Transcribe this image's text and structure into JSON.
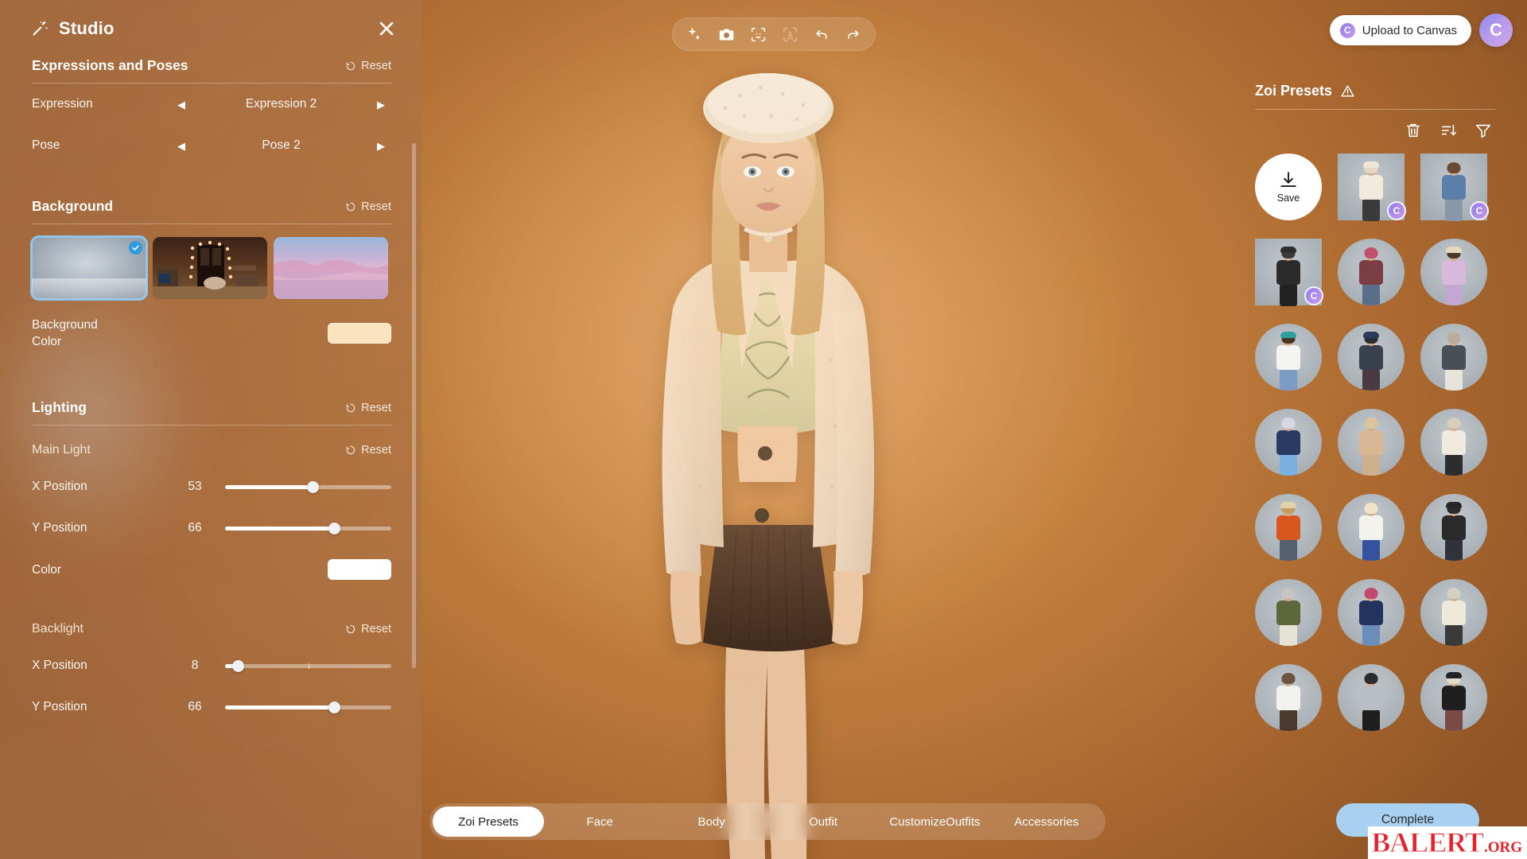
{
  "studio": {
    "title": "Studio",
    "wand_icon": "magic-wand-icon",
    "close_icon": "close-icon",
    "sections": {
      "expressions": {
        "title": "Expressions and Poses",
        "reset_label": "Reset",
        "rows": [
          {
            "label": "Expression",
            "value": "Expression 2"
          },
          {
            "label": "Pose",
            "value": "Pose 2"
          }
        ]
      },
      "background": {
        "title": "Background",
        "reset_label": "Reset",
        "thumbnails": [
          {
            "name": "studio-backdrop",
            "selected": true
          },
          {
            "name": "interior-room",
            "selected": false
          },
          {
            "name": "sunset-ocean",
            "selected": false
          }
        ],
        "color_label_line1": "Background",
        "color_label_line2": "Color",
        "color_value": "#fae3bd"
      },
      "lighting": {
        "title": "Lighting",
        "reset_label": "Reset",
        "main_light": {
          "title": "Main Light",
          "reset_label": "Reset",
          "x_label": "X Position",
          "x_value": 53,
          "y_label": "Y Position",
          "y_value": 66,
          "color_label": "Color",
          "color_value": "#ffffff"
        },
        "backlight": {
          "title": "Backlight",
          "reset_label": "Reset",
          "x_label": "X Position",
          "x_value": 8,
          "y_label": "Y Position",
          "y_value": 66
        }
      }
    }
  },
  "toolbar": {
    "items": [
      {
        "icon": "sparkle-icon",
        "enabled": true
      },
      {
        "icon": "camera-icon",
        "enabled": true
      },
      {
        "icon": "face-scan-icon",
        "enabled": true
      },
      {
        "icon": "body-scan-icon",
        "enabled": false
      },
      {
        "icon": "undo-icon",
        "enabled": true
      },
      {
        "icon": "redo-icon",
        "enabled": true
      }
    ]
  },
  "header": {
    "upload_label": "Upload to Canvas",
    "upload_icon": "canvas-logo-icon",
    "profile_icon": "profile-avatar"
  },
  "presets": {
    "title": "Zoi Presets",
    "warning_icon": "warning-triangle-icon",
    "tools": [
      {
        "icon": "trash-icon"
      },
      {
        "icon": "sort-icon"
      },
      {
        "icon": "filter-icon"
      }
    ],
    "save_label": "Save",
    "save_icon": "download-icon",
    "items": [
      {
        "name": "preset-white-tweed-beret",
        "badge": "C",
        "hair": "#e8d8c2",
        "hat": "#efe6d6",
        "torso": "#f2eadd",
        "legs": "#3a3a3a"
      },
      {
        "name": "preset-denim-jacket-curly",
        "badge": "C",
        "hair": "#6b4a32",
        "hat": "",
        "torso": "#5b7fa8",
        "legs": "#8a97a8"
      },
      {
        "name": "preset-black-dress-cat-ears",
        "badge": "C",
        "hair": "#3b3b3b",
        "hat": "#2e2e2e",
        "torso": "#2b2b2b",
        "legs": "#222222"
      },
      {
        "name": "preset-varsity-windbreaker",
        "badge": "",
        "hair": "#c2506a",
        "hat": "",
        "torso": "#7b3c44",
        "legs": "#5a6e8a"
      },
      {
        "name": "preset-pastel-sundress",
        "badge": "",
        "hair": "#4b3a2c",
        "hat": "#e4d8bd",
        "torso": "#d8b8dc",
        "legs": "#c2a7d3"
      },
      {
        "name": "preset-white-tee-bandana",
        "badge": "",
        "hair": "#4a3526",
        "hat": "#2f9e9e",
        "torso": "#f4f4f2",
        "legs": "#7b9ac4"
      },
      {
        "name": "preset-navy-hooded-coat",
        "badge": "",
        "hair": "#2b2b33",
        "hat": "#2a3a5c",
        "torso": "#39414f",
        "legs": "#4a3a42"
      },
      {
        "name": "preset-grey-bomber",
        "badge": "",
        "hair": "#b9ae9c",
        "hat": "",
        "torso": "#4a4f54",
        "legs": "#e8e4da"
      },
      {
        "name": "preset-blue-shorts-jacket",
        "badge": "",
        "hair": "#d8d8e4",
        "hat": "",
        "torso": "#2b3a63",
        "legs": "#7ab0e0"
      },
      {
        "name": "preset-beige-knit-dress",
        "badge": "",
        "hair": "#d9c49c",
        "hat": "",
        "torso": "#d8b894",
        "legs": "#cfae8c"
      },
      {
        "name": "preset-white-stripe-shirt",
        "badge": "",
        "hair": "#d8cdb9",
        "hat": "",
        "torso": "#efeadd",
        "legs": "#2d2d2d"
      },
      {
        "name": "preset-orange-shirt-hat",
        "badge": "",
        "hair": "#c79a5e",
        "hat": "#e0d2ac",
        "torso": "#d9571f",
        "legs": "#55606e"
      },
      {
        "name": "preset-white-cardigan-skirt",
        "badge": "",
        "hair": "#f0e2c6",
        "hat": "",
        "torso": "#f4f2ec",
        "legs": "#35529c"
      },
      {
        "name": "preset-black-coat-beret",
        "badge": "",
        "hair": "#2b2b2b",
        "hat": "#262626",
        "torso": "#2a2a2a",
        "legs": "#31313a"
      },
      {
        "name": "preset-military-jacket",
        "badge": "",
        "hair": "#c9c4c4",
        "hat": "",
        "torso": "#5e663c",
        "legs": "#e6e2d6"
      },
      {
        "name": "preset-navy-varsity-pink",
        "badge": "",
        "hair": "#c4486a",
        "hat": "",
        "torso": "#23335e",
        "legs": "#6b8dbb"
      },
      {
        "name": "preset-cream-sweatshirt",
        "badge": "",
        "hair": "#d5d0c4",
        "hat": "",
        "torso": "#efe9dc",
        "legs": "#3a3a3a"
      },
      {
        "name": "preset-white-tee-brown-skirt",
        "badge": "",
        "hair": "#6b5540",
        "hat": "",
        "torso": "#f2f2ee",
        "legs": "#4a392c"
      },
      {
        "name": "preset-silver-jacket-crop",
        "badge": "",
        "hair": "#2b2b2b",
        "hat": "",
        "torso": "#b9bec4",
        "legs": "#1e1e1e"
      },
      {
        "name": "preset-black-top-cap",
        "badge": "",
        "hair": "#e4dcc9",
        "hat": "#232323",
        "torso": "#1f1f1f",
        "legs": "#7b4a45"
      }
    ]
  },
  "tabs": [
    {
      "label": "Zoi Presets",
      "active": true
    },
    {
      "label": "Face",
      "active": false
    },
    {
      "label": "Body",
      "active": false
    },
    {
      "label": "Outfit",
      "active": false
    },
    {
      "label": "Customize\nOutfits",
      "active": false
    },
    {
      "label": "Accessories",
      "active": false
    }
  ],
  "footer": {
    "complete_label": "Complete"
  },
  "watermark": {
    "main": "BALERT",
    "tld": ".ORG"
  }
}
